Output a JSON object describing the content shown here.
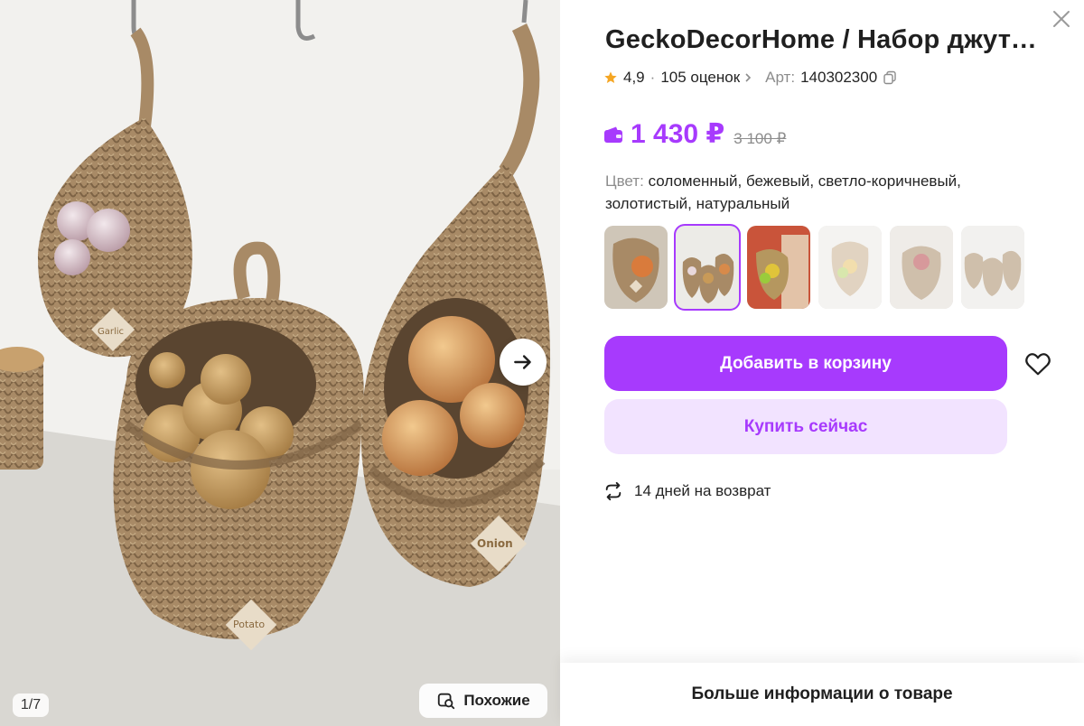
{
  "gallery": {
    "counter": "1/7",
    "similar_label": "Похожие",
    "tag_garlic": "Garlic",
    "tag_potato": "Potato",
    "tag_onion": "Onion"
  },
  "product": {
    "title": "GeckoDecorHome / Набор джуто...",
    "rating": "4,9",
    "reviews": "105 оценок",
    "art_label": "Арт:",
    "art_value": "140302300",
    "price": "1 430 ₽",
    "old_price": "3 100 ₽",
    "color_label": "Цвет:",
    "color_value": "соломенный, бежевый, светло-коричневый, золотистый, натуральный"
  },
  "thumbnails": {
    "count": 6,
    "selected_index": 1
  },
  "actions": {
    "add_to_cart": "Добавить в корзину",
    "buy_now": "Купить сейчас"
  },
  "returns": {
    "label": "14 дней на возврат"
  },
  "footer": {
    "more_info": "Больше информации о товаре"
  },
  "colors": {
    "accent": "#a73afd",
    "accent_light": "#f2e3ff",
    "jute": "#a88a66",
    "star": "#f5a623"
  },
  "icons": [
    "close-icon",
    "star-icon",
    "chevron-right-icon",
    "copy-icon",
    "wallet-icon",
    "heart-icon",
    "return-icon",
    "arrow-right-icon",
    "search-similar-icon"
  ]
}
